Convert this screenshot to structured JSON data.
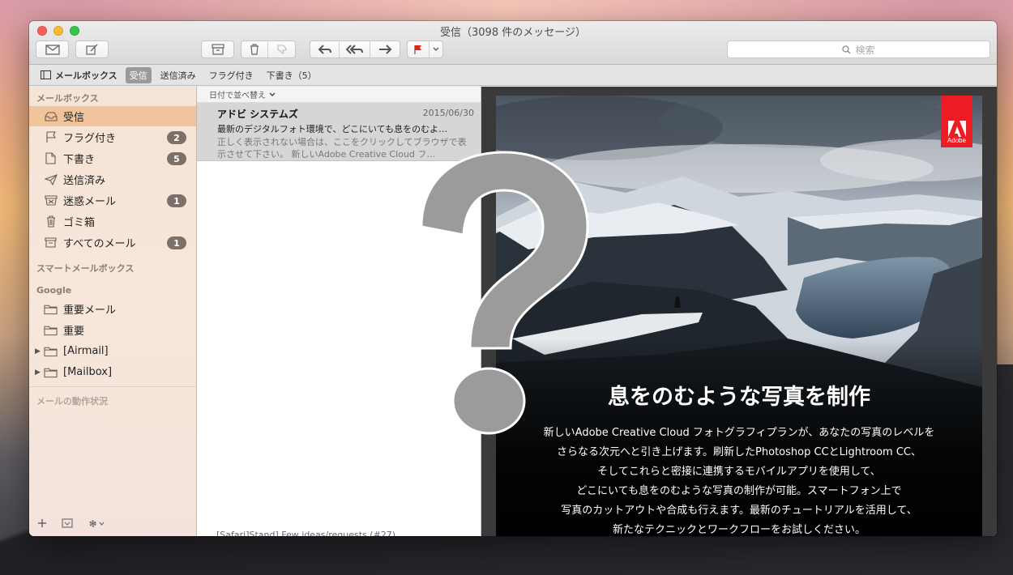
{
  "window": {
    "title": "受信（3098 件のメッセージ）"
  },
  "toolbar": {
    "search_placeholder": "検索",
    "flag_color": "#e0201a"
  },
  "favorites": {
    "mailboxes_label": "メールボックス",
    "items": [
      "受信",
      "送信済み",
      "フラグ付き",
      "下書き（5）"
    ]
  },
  "sidebar": {
    "section_mailboxes": "メールボックス",
    "items": [
      {
        "label": "受信",
        "icon": "inbox-icon",
        "badge": ""
      },
      {
        "label": "フラグ付き",
        "icon": "flag-icon",
        "badge": "2"
      },
      {
        "label": "下書き",
        "icon": "draft-icon",
        "badge": "5"
      },
      {
        "label": "送信済み",
        "icon": "sent-icon",
        "badge": ""
      },
      {
        "label": "迷惑メール",
        "icon": "junk-icon",
        "badge": "1"
      },
      {
        "label": "ゴミ箱",
        "icon": "trash-icon",
        "badge": ""
      },
      {
        "label": "すべてのメール",
        "icon": "archive-icon",
        "badge": "1"
      }
    ],
    "section_smart": "スマートメールボックス",
    "section_google": "Google",
    "google_items": [
      {
        "label": "重要メール",
        "icon": "folder-icon"
      },
      {
        "label": "重要",
        "icon": "folder-icon"
      },
      {
        "label": "[Airmail]",
        "icon": "folder-icon"
      },
      {
        "label": "[Mailbox]",
        "icon": "folder-icon"
      }
    ],
    "section_activity": "メールの動作状況"
  },
  "message_list": {
    "sort_label": "日付で並べ替え",
    "messages": [
      {
        "sender": "アドビ システムズ",
        "date": "2015/06/30",
        "subject": "最新のデジタルフォト環境で、どこにいても息をのむよ…",
        "preview": "正しく表示されない場合は、ここをクリックしてブラウザで表示させて下さい。 新しいAdobe Creative Cloud フ…"
      }
    ],
    "cut_off_text": "[Safari]Stand] Few ideas/requests (#27)"
  },
  "preview": {
    "logo_text": "Adobe",
    "headline": "息をのむような写真を制作",
    "body_lines": [
      "新しいAdobe Creative Cloud フォトグラフィプランが、あなたの写真のレベルを",
      "さらなる次元へと引き上げます。刷新したPhotoshop CCとLightroom CC、",
      "そしてこれらと密接に連携するモバイルアプリを使用して、",
      "どこにいても息をのむような写真の制作が可能。スマートフォン上で",
      "写真のカットアウトや合成も行えます。最新のチュートリアルを活用して、",
      "新たなテクニックとワークフローをお試しください。"
    ]
  },
  "overlay": {
    "glyph": "?"
  }
}
